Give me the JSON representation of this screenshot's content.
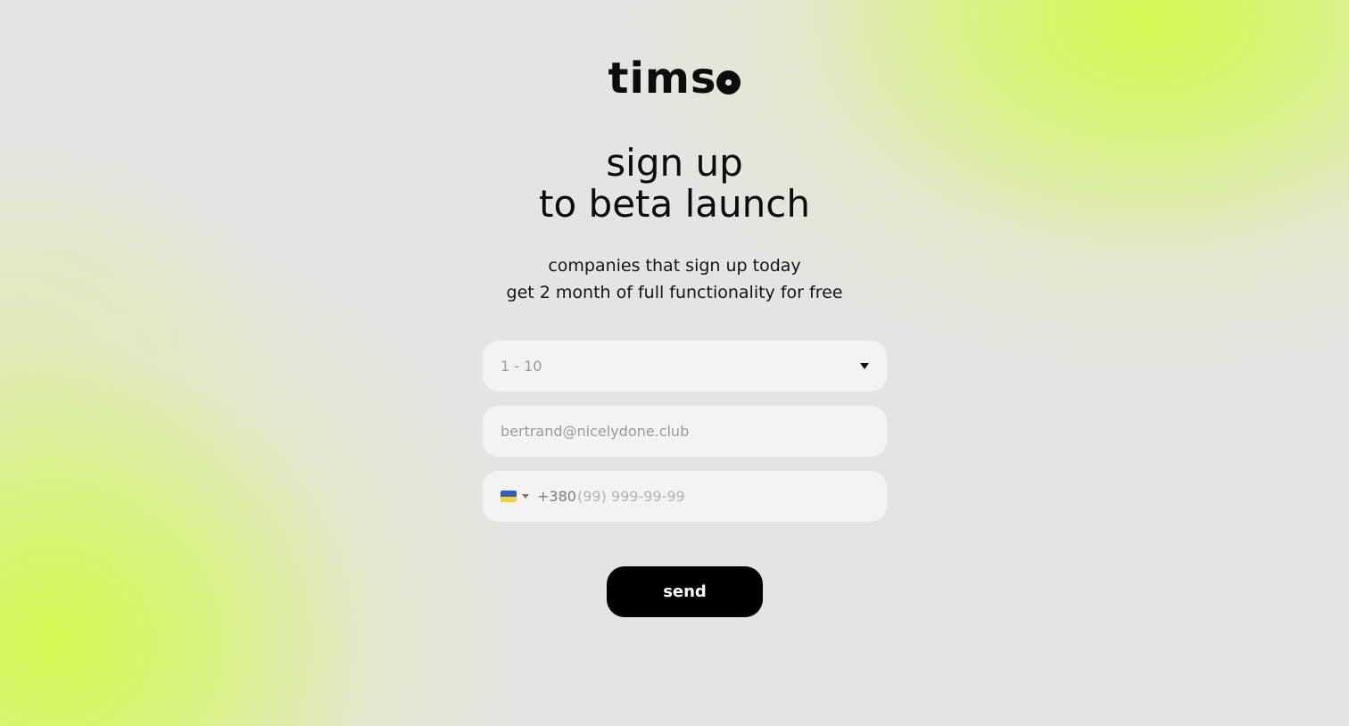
{
  "logo": {
    "text": "tims",
    "dot_icon": "o-dot-logo-glyph"
  },
  "heading": {
    "line1": "sign up",
    "line2": "to beta launch"
  },
  "subtext": {
    "line1": "companies that sign up today",
    "line2": "get 2 month of full functionality for free"
  },
  "form": {
    "company_size": {
      "value": "1 - 10",
      "icon": "chevron-down-icon"
    },
    "email": {
      "placeholder": "bertrand@nicelydone.club"
    },
    "phone": {
      "country_flag": "ukraine-flag-icon",
      "dial_code": "+380",
      "placeholder": "(99) 999-99-99"
    },
    "submit_label": "send"
  },
  "colors": {
    "background": "#e4e4e4",
    "accent_gradient": "#d3f950",
    "field_background": "#f3f3f3",
    "button_background": "#000000",
    "button_text": "#ffffff"
  }
}
